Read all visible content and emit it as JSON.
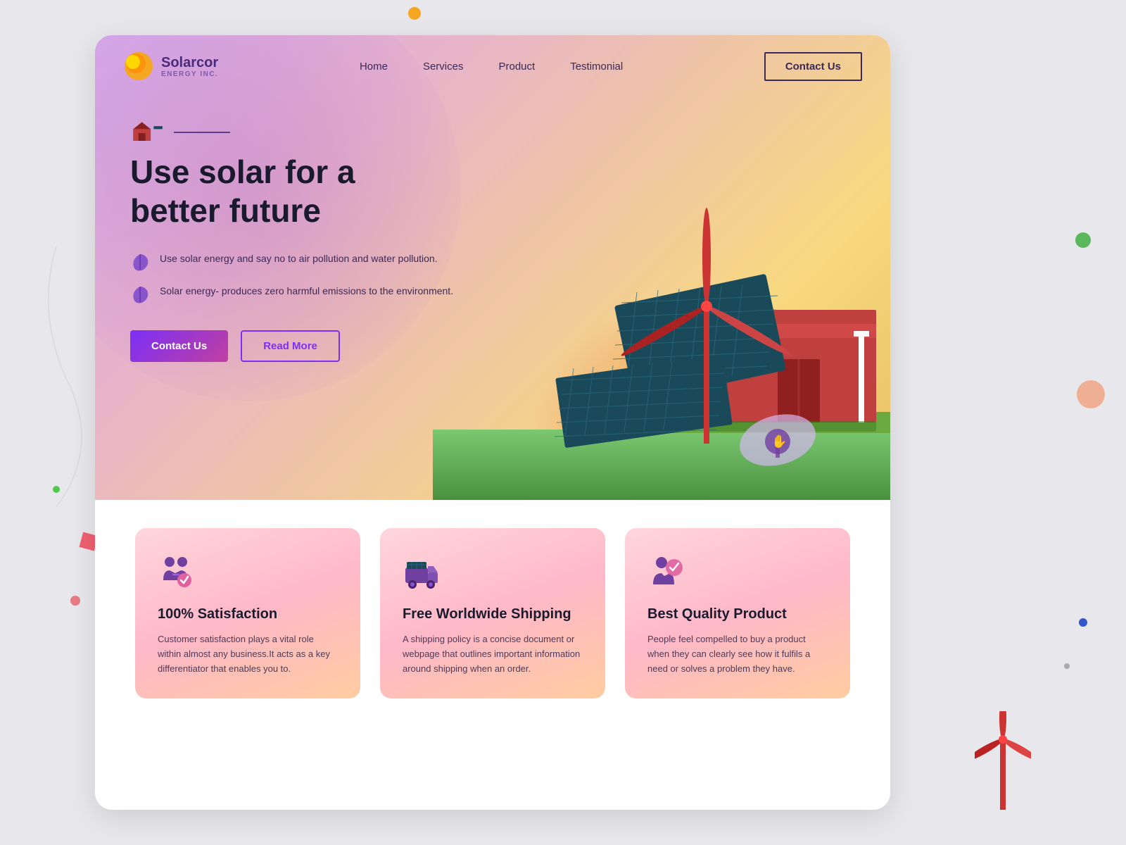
{
  "page": {
    "title": "Solarcor Energy Inc.",
    "background": "#e8e8ec"
  },
  "logo": {
    "name": "Solarcor",
    "subtitle": "ENERGY INC."
  },
  "nav": {
    "links": [
      {
        "label": "Home",
        "id": "home"
      },
      {
        "label": "Services",
        "id": "services"
      },
      {
        "label": "Product",
        "id": "product"
      },
      {
        "label": "Testimonial",
        "id": "testimonial"
      }
    ],
    "contact_btn": "Contact Us"
  },
  "hero": {
    "title_line1": "Use solar for a",
    "title_line2": "better future",
    "feature1": "Use solar energy and say no to air pollution and water pollution.",
    "feature2": "Solar energy- produces zero harmful emissions to the environment.",
    "btn_contact": "Contact Us",
    "btn_read_more": "Read More"
  },
  "cards": [
    {
      "icon": "satisfaction-icon",
      "title": "100% Satisfaction",
      "desc": "Customer satisfaction plays a vital role within almost any business.It acts as a key differentiator that enables you to."
    },
    {
      "icon": "shipping-icon",
      "title": "Free Worldwide Shipping",
      "desc": "A shipping policy is a concise document or webpage that outlines important information around shipping when an order."
    },
    {
      "icon": "quality-icon",
      "title": "Best Quality Product",
      "desc": "People feel compelled to buy a product when they can clearly see how it fulfils a need or solves a problem they have."
    }
  ]
}
